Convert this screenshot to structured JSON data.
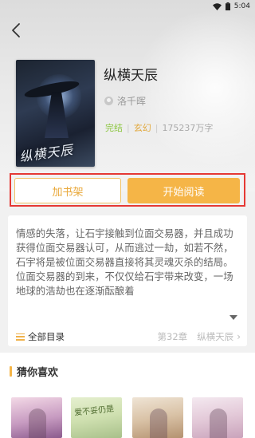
{
  "status_bar": {
    "time": "5:04"
  },
  "book": {
    "cover_text": "纵横天辰",
    "title": "纵横天辰",
    "author": "洛千晖",
    "status": "完结",
    "genre": "玄幻",
    "word_count": "175237万字",
    "separator": "|"
  },
  "actions": {
    "add_shelf_label": "加书架",
    "start_reading_label": "开始阅读"
  },
  "intro": {
    "text": "情感的失落，让石宇接触到位面交易器，并且成功获得位面交易器认可，从而逃过一劫，如若不然，石宇将是被位面交易器直接将其灵魂灭杀的结局。位面交易器的到来，不仅仅给石宇带来改变，一场地球的浩劫也在逐渐酝酿着",
    "toc_label": "全部目录",
    "latest_chapter": "第32章",
    "latest_chapter_title": "纵横天辰",
    "chevron": "›"
  },
  "recommend": {
    "title": "猜你喜欢",
    "books": [
      {
        "cover_text": ""
      },
      {
        "cover_text": "爱不妥仍是"
      },
      {
        "cover_text": ""
      },
      {
        "cover_text": ""
      }
    ]
  },
  "colors": {
    "accent": "#f5b547",
    "highlight_frame": "#e53935",
    "status_green": "#8cc63f",
    "genre_orange": "#e2a83b"
  }
}
